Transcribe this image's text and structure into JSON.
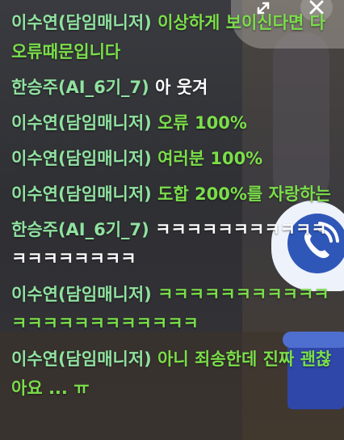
{
  "messages": [
    {
      "name": "이수연(담임매니저)",
      "text": "이상하게 보이신다면 다 오류때문입니다",
      "highlight": true
    },
    {
      "name": "한승주(AI_6기_7)",
      "text": "아 웃겨",
      "highlight": false
    },
    {
      "name": "이수연(담임매니저)",
      "text": "오류 100%",
      "highlight": true
    },
    {
      "name": "이수연(담임매니저)",
      "text": "여러분 100%",
      "highlight": true
    },
    {
      "name": "이수연(담임매니저)",
      "text": "도합 200%를 자랑하는",
      "highlight": true
    },
    {
      "name": "한승주(AI_6기_7)",
      "text": "ㅋㅋㅋㅋㅋㅋㅋㅋㅋㅋㅋㅋㅋㅋㅋㅋㅋㅋㅋ",
      "highlight": false
    },
    {
      "name": "이수연(담임매니저)",
      "text": "ㅋㅋㅋㅋㅋㅋㅋㅋㅋㅋㅋㅋㅋㅋㅋㅋㅋㅋㅋㅋㅋㅋㅋ",
      "highlight": true
    },
    {
      "name": "이수연(담임매니저)",
      "text": "아니 죄송한데 진짜 괜찮아요 ... ㅠ",
      "highlight": true
    }
  ],
  "colors": {
    "name": "#90e2a0",
    "highlight_text": "#7bde4a",
    "normal_text": "#ffffff"
  },
  "controls": {
    "expand_icon": "expand-arrows-icon",
    "close_icon": "close-icon"
  }
}
